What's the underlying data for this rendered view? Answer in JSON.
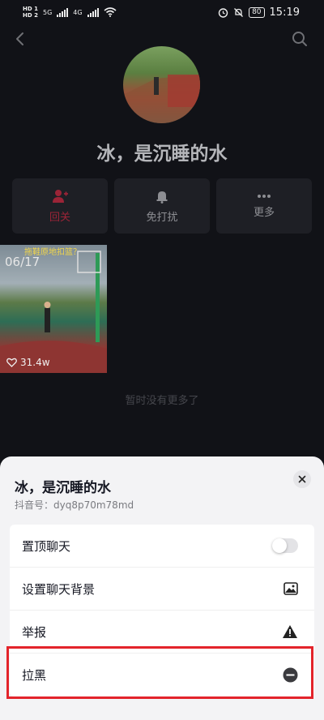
{
  "status_bar": {
    "hd1": "HD 1",
    "hd2": "HD 2",
    "net1": "5G",
    "net2": "4G",
    "battery": "80",
    "time": "15:19"
  },
  "profile": {
    "name": "冰，是沉睡的水"
  },
  "actions": [
    {
      "label": "回关",
      "icon": "follow-back-icon",
      "color": "#9b2437"
    },
    {
      "label": "免打扰",
      "icon": "bell-icon"
    },
    {
      "label": "更多",
      "icon": "more-dots-icon"
    }
  ],
  "video": {
    "overlay_text": "拖鞋原地扣篮？",
    "date": "06/17",
    "likes": "31.4w"
  },
  "no_more_text": "暂时没有更多了",
  "sheet": {
    "title": "冰，是沉睡的水",
    "account_id": "抖音号：dyq8p70m78md",
    "close_icon": "close-icon",
    "items": [
      {
        "label": "置顶聊天",
        "control": "toggle",
        "value": false
      },
      {
        "label": "设置聊天背景",
        "icon": "image-icon"
      },
      {
        "label": "举报",
        "icon": "warning-icon"
      },
      {
        "label": "拉黑",
        "icon": "block-icon"
      }
    ]
  },
  "highlight_color": "#e3242b"
}
